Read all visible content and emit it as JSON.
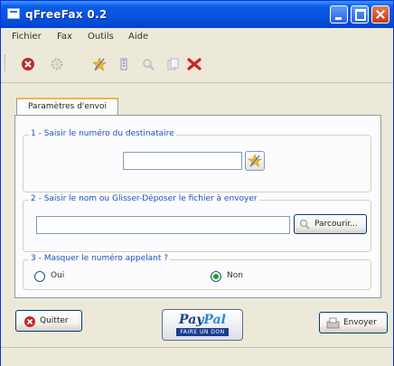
{
  "window": {
    "title": "qFreeFax 0.2"
  },
  "menu": [
    "Fichier",
    "Fax",
    "Outils",
    "Aide"
  ],
  "toolbar": {
    "icons": [
      "stop-icon",
      "gear-icon",
      "star-icon",
      "edit-icon",
      "search-icon",
      "copy-icon",
      "delete-icon"
    ]
  },
  "tab": {
    "label": "Paramètres d'envoi"
  },
  "group1": {
    "legend": "1 - Saisir le numéro du destinataire",
    "number_value": ""
  },
  "group2": {
    "legend": "2 - Saisir le nom ou Glisser-Déposer le fichier à envoyer",
    "file_value": "",
    "browse_label": "Parcourir..."
  },
  "group3": {
    "legend": "3 - Masquer le numéro appelant ?",
    "option_yes": "Oui",
    "option_no": "Non",
    "selected": "Non"
  },
  "footer": {
    "quit_label": "Quitter",
    "paypal_brand_pay": "Pay",
    "paypal_brand_pal": "Pal",
    "paypal_sub": "FAIRE UN DON",
    "send_label": "Envoyer"
  },
  "colors": {
    "title_bar": "#0a5ce8",
    "legend_text": "#1d4fbd",
    "tab_accent": "#f7b247"
  }
}
